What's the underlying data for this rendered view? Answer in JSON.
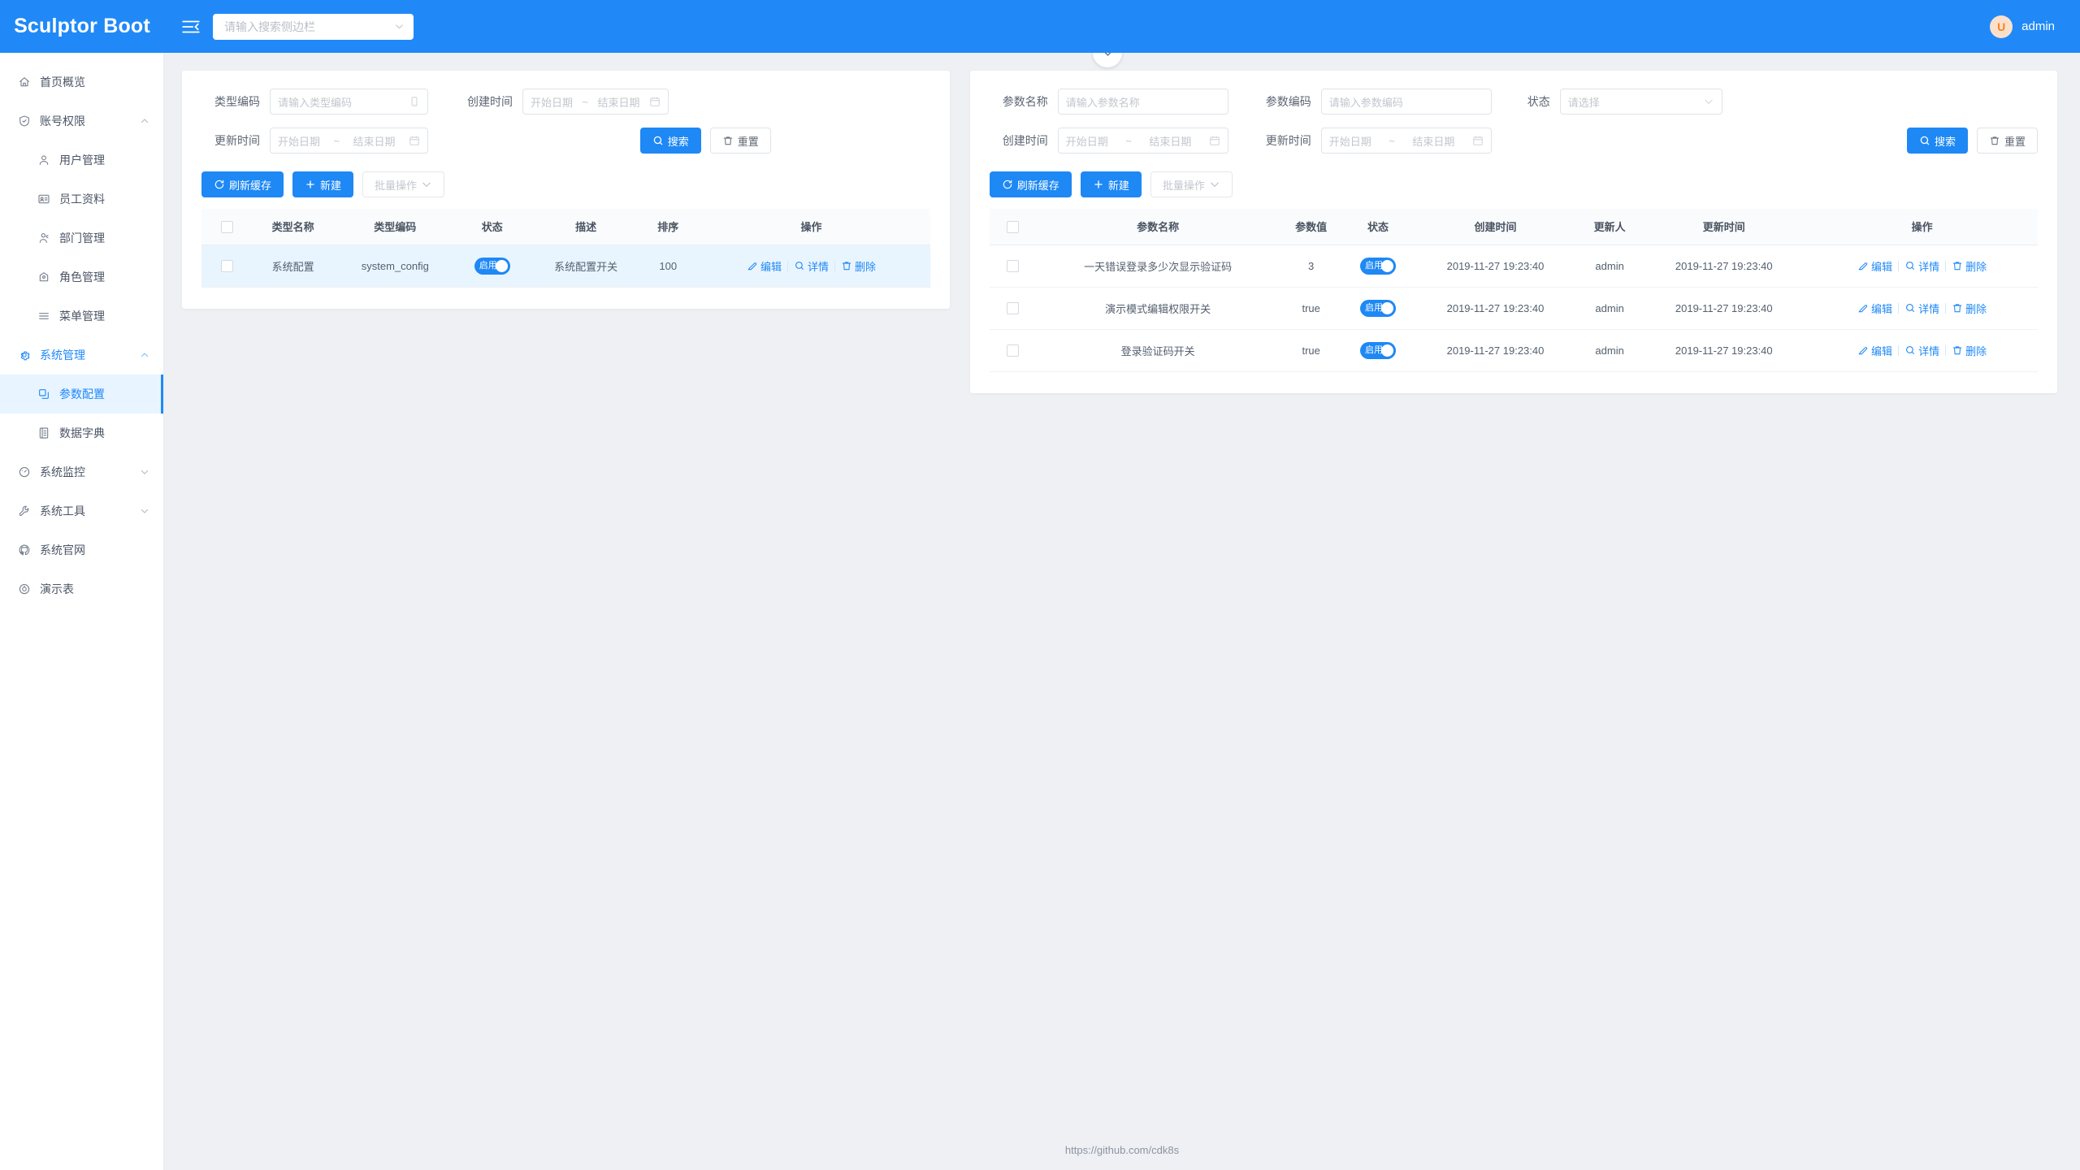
{
  "header": {
    "brand": "Sculptor Boot",
    "collapse_icon": "menu-fold-icon",
    "search_placeholder": "请输入搜索侧边栏",
    "avatar_initial": "U",
    "username": "admin",
    "accent_color": "#2089f7"
  },
  "sidebar": {
    "items": [
      {
        "label": "首页概览",
        "icon": "home-icon",
        "level": 0,
        "state": "default",
        "arrow": "none"
      },
      {
        "label": "账号权限",
        "icon": "shield-check-icon",
        "level": 0,
        "state": "default",
        "arrow": "up"
      },
      {
        "label": "用户管理",
        "icon": "user-icon",
        "level": 1,
        "state": "default",
        "arrow": "none"
      },
      {
        "label": "员工资料",
        "icon": "id-card-icon",
        "level": 1,
        "state": "default",
        "arrow": "none"
      },
      {
        "label": "部门管理",
        "icon": "team-icon",
        "level": 1,
        "state": "default",
        "arrow": "none"
      },
      {
        "label": "角色管理",
        "icon": "role-icon",
        "level": 1,
        "state": "default",
        "arrow": "none"
      },
      {
        "label": "菜单管理",
        "icon": "menu-list-icon",
        "level": 1,
        "state": "default",
        "arrow": "none"
      },
      {
        "label": "系统管理",
        "icon": "gear-icon",
        "level": 0,
        "state": "open",
        "arrow": "up"
      },
      {
        "label": "参数配置",
        "icon": "copy-icon",
        "level": 1,
        "state": "active",
        "arrow": "none"
      },
      {
        "label": "数据字典",
        "icon": "book-icon",
        "level": 1,
        "state": "default",
        "arrow": "none"
      },
      {
        "label": "系统监控",
        "icon": "dashboard-icon",
        "level": 0,
        "state": "default",
        "arrow": "down"
      },
      {
        "label": "系统工具",
        "icon": "wrench-icon",
        "level": 0,
        "state": "default",
        "arrow": "down"
      },
      {
        "label": "系统官网",
        "icon": "github-icon",
        "level": 0,
        "state": "default",
        "arrow": "none"
      },
      {
        "label": "演示表",
        "icon": "compass-icon",
        "level": 0,
        "state": "default",
        "arrow": "none"
      }
    ]
  },
  "collapse_tab": {
    "icon": "chevron-down-icon"
  },
  "left_panel": {
    "form": {
      "type_code_label": "类型编码",
      "type_code_placeholder": "请输入类型编码",
      "create_time_label": "创建时间",
      "update_time_label": "更新时间",
      "start_date_placeholder": "开始日期",
      "end_date_placeholder": "结束日期",
      "range_separator": "~",
      "search_button": "搜索",
      "reset_button": "重置"
    },
    "toolbar": {
      "refresh_cache": "刷新缓存",
      "create": "新建",
      "batch": "批量操作"
    },
    "table": {
      "columns": [
        "类型名称",
        "类型编码",
        "状态",
        "描述",
        "排序",
        "操作"
      ],
      "rows": [
        {
          "name": "系统配置",
          "code": "system_config",
          "status": "启用",
          "desc": "系统配置开关",
          "sort": "100",
          "highlighted": true
        }
      ],
      "actions": [
        "编辑",
        "详情",
        "删除"
      ]
    }
  },
  "right_panel": {
    "form": {
      "param_name_label": "参数名称",
      "param_name_placeholder": "请输入参数名称",
      "param_code_label": "参数编码",
      "param_code_placeholder": "请输入参数编码",
      "status_label": "状态",
      "status_placeholder": "请选择",
      "create_time_label": "创建时间",
      "update_time_label": "更新时间",
      "start_date_placeholder": "开始日期",
      "end_date_placeholder": "结束日期",
      "range_separator": "~",
      "search_button": "搜索",
      "reset_button": "重置"
    },
    "toolbar": {
      "refresh_cache": "刷新缓存",
      "create": "新建",
      "batch": "批量操作"
    },
    "table": {
      "columns": [
        "参数名称",
        "参数值",
        "状态",
        "创建时间",
        "更新人",
        "更新时间",
        "操作"
      ],
      "rows": [
        {
          "name": "一天错误登录多少次显示验证码",
          "value": "3",
          "status": "启用",
          "created": "2019-11-27 19:23:40",
          "updater": "admin",
          "updated": "2019-11-27 19:23:40"
        },
        {
          "name": "演示模式编辑权限开关",
          "value": "true",
          "status": "启用",
          "created": "2019-11-27 19:23:40",
          "updater": "admin",
          "updated": "2019-11-27 19:23:40"
        },
        {
          "name": "登录验证码开关",
          "value": "true",
          "status": "启用",
          "created": "2019-11-27 19:23:40",
          "updater": "admin",
          "updated": "2019-11-27 19:23:40"
        }
      ],
      "actions": [
        "编辑",
        "详情",
        "删除"
      ]
    }
  },
  "footer": {
    "link": "https://github.com/cdk8s"
  }
}
